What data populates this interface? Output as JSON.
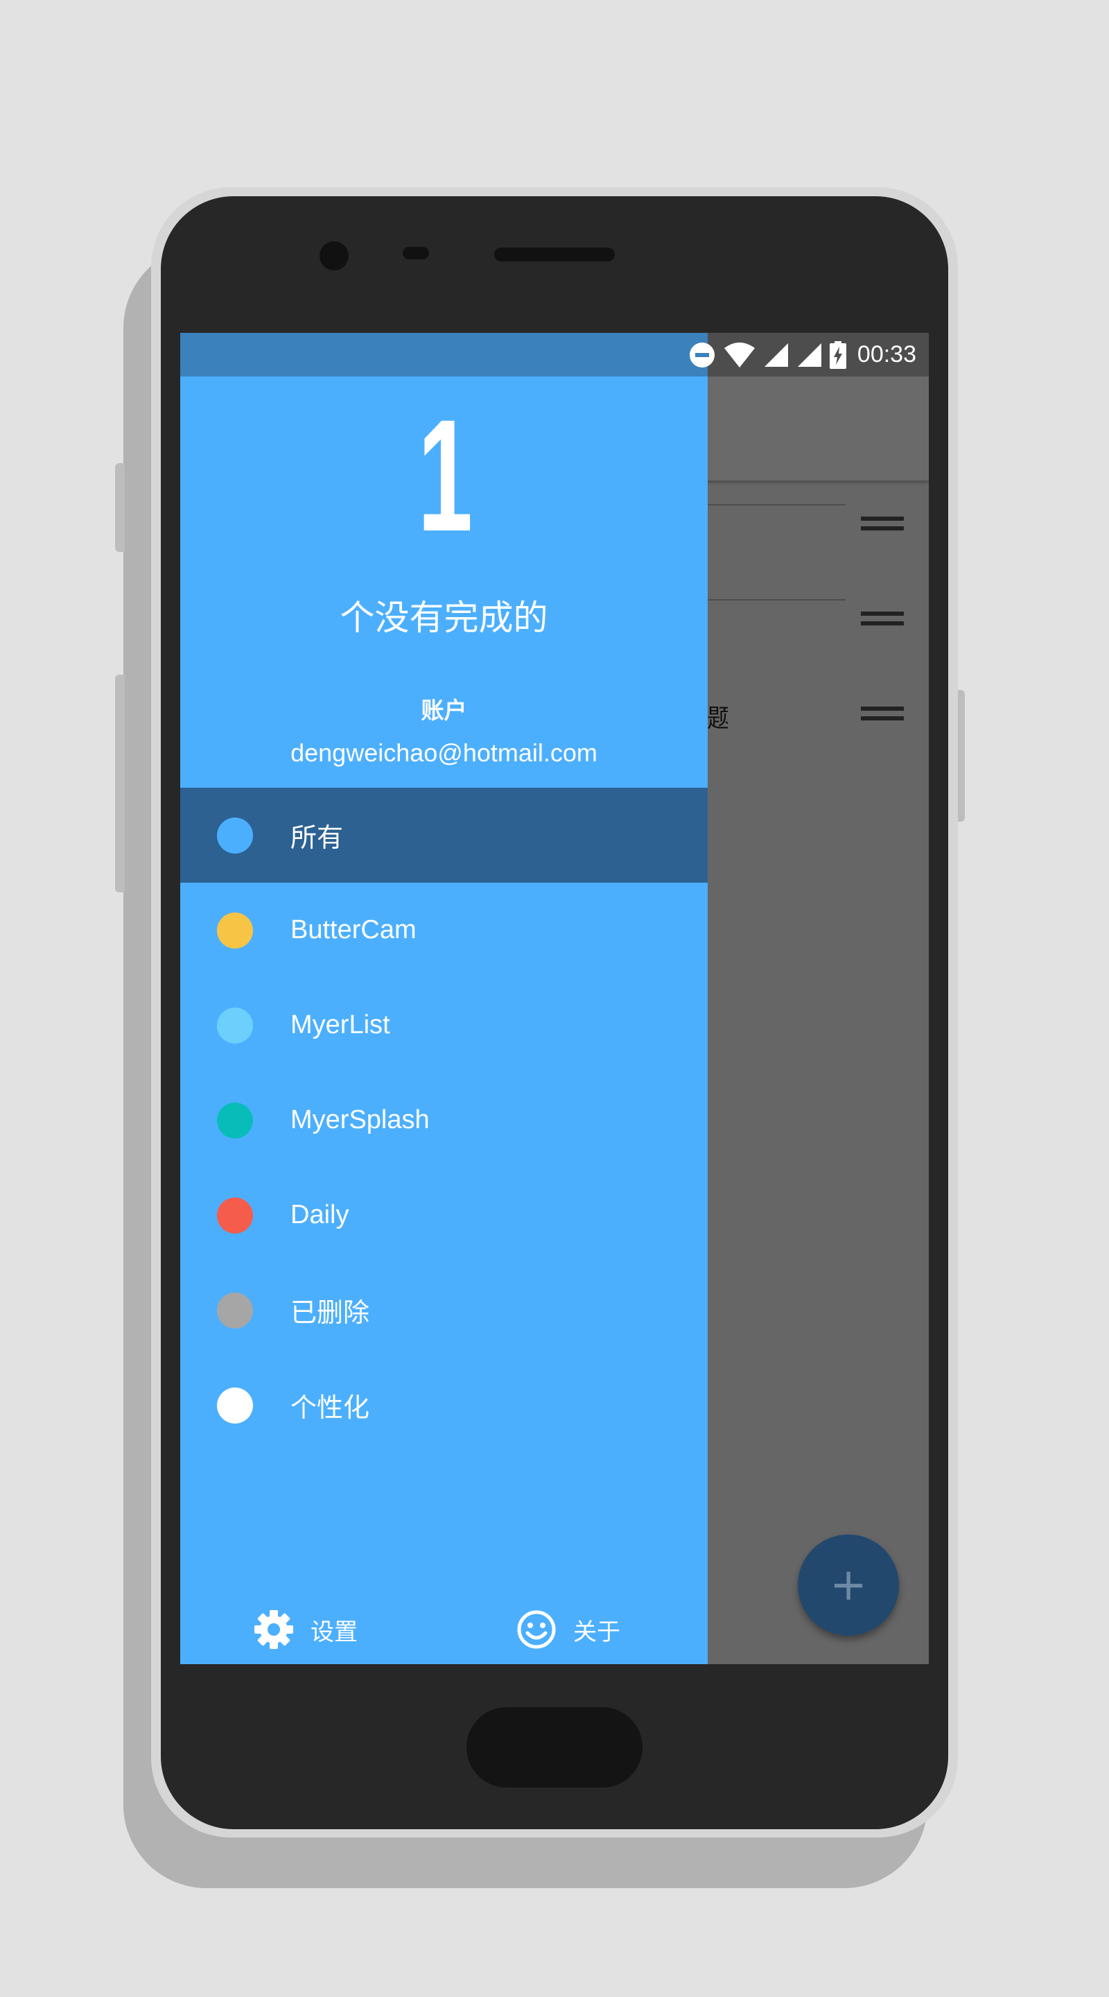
{
  "status_bar": {
    "time": "00:33",
    "icons": [
      "do-not-disturb-icon",
      "wifi-icon",
      "signal-icon",
      "signal-icon",
      "battery-charging-icon"
    ]
  },
  "drawer": {
    "undone_count": "1",
    "undone_label": "个没有完成的",
    "account_title": "账户",
    "account_email": "dengweichao@hotmail.com",
    "categories": [
      {
        "label": "所有",
        "color": "#4caffe",
        "selected": true
      },
      {
        "label": "ButterCam",
        "color": "#f8c445",
        "selected": false
      },
      {
        "label": "MyerList",
        "color": "#6dd0fc",
        "selected": false
      },
      {
        "label": "MyerSplash",
        "color": "#08bdb9",
        "selected": false
      },
      {
        "label": "Daily",
        "color": "#f55c4b",
        "selected": false
      },
      {
        "label": "已删除",
        "color": "#a6a6a6",
        "selected": false
      },
      {
        "label": "个性化",
        "color": "#ffffff",
        "selected": false
      }
    ],
    "footer": {
      "settings_label": "设置",
      "settings_icon": "gear-icon",
      "about_label": "关于",
      "about_icon": "smiley-icon"
    }
  },
  "background_app": {
    "partial_item_text": "题",
    "fab_icon": "plus-icon",
    "fab_label": "+"
  }
}
